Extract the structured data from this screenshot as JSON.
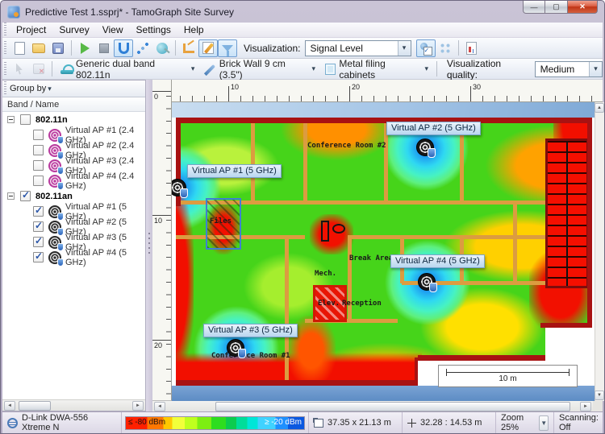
{
  "window": {
    "title": "Predictive Test 1.ssprj* - TamoGraph Site Survey"
  },
  "menu": {
    "items": [
      "Project",
      "Survey",
      "View",
      "Settings",
      "Help"
    ]
  },
  "toolbar": {
    "visualization_label": "Visualization:",
    "visualization_value": "Signal Level"
  },
  "object_bar": {
    "ap_model": "Generic dual band 802.11n",
    "wall_type": "Brick Wall 9 cm (3.5\")",
    "obstruction_type": "Metal filing cabinets",
    "quality_label": "Visualization quality:",
    "quality_value": "Medium"
  },
  "sidebar": {
    "group_by": "Group by",
    "column": "Band / Name",
    "groups": [
      {
        "label": "802.11n",
        "checked": false,
        "items": [
          {
            "label": "Virtual AP #1 (2.4 GHz)",
            "checked": false
          },
          {
            "label": "Virtual AP #2 (2.4 GHz)",
            "checked": false
          },
          {
            "label": "Virtual AP #3 (2.4 GHz)",
            "checked": false
          },
          {
            "label": "Virtual AP #4 (2.4 GHz)",
            "checked": false
          }
        ]
      },
      {
        "label": "802.11an",
        "checked": true,
        "items": [
          {
            "label": "Virtual AP #1 (5 GHz)",
            "checked": true
          },
          {
            "label": "Virtual AP #2 (5 GHz)",
            "checked": true
          },
          {
            "label": "Virtual AP #3 (5 GHz)",
            "checked": true
          },
          {
            "label": "Virtual AP #4 (5 GHz)",
            "checked": true
          }
        ]
      }
    ]
  },
  "map": {
    "h_ruler": [
      "10",
      "20",
      "30"
    ],
    "v_ruler": [
      "0",
      "10",
      "20"
    ],
    "ap_markers": [
      {
        "label": "Virtual AP #1 (5 GHz)"
      },
      {
        "label": "Virtual AP #2 (5 GHz)"
      },
      {
        "label": "Virtual AP #3 (5 GHz)"
      },
      {
        "label": "Virtual AP #4 (5 GHz)"
      }
    ],
    "rooms": [
      "Conference Room #2",
      "Files",
      "Break Area",
      "Mech.",
      "Elev.",
      "Reception",
      "Conference Room #1"
    ],
    "scale_label": "10 m"
  },
  "statusbar": {
    "adapter": "D-Link DWA-556 Xtreme N",
    "legend_min": "≤ -80 dBm",
    "legend_max": "≥ -20 dBm",
    "plan_size": "37.35 x 21.13 m",
    "cursor_pos": "32.28 : 14.53 m",
    "zoom": "Zoom 25%",
    "scanning": "Scanning: Off"
  },
  "colors": {
    "accent": "#3b78c4",
    "heat_legend": [
      "#ff2000",
      "#ff7700",
      "#ffc800",
      "#f2ff3a",
      "#bfff1e",
      "#7dee11",
      "#2edd1f",
      "#0ccc4e",
      "#00dd9a",
      "#00e6d8",
      "#3fd2ff",
      "#1e90ff",
      "#0a58e0"
    ]
  }
}
